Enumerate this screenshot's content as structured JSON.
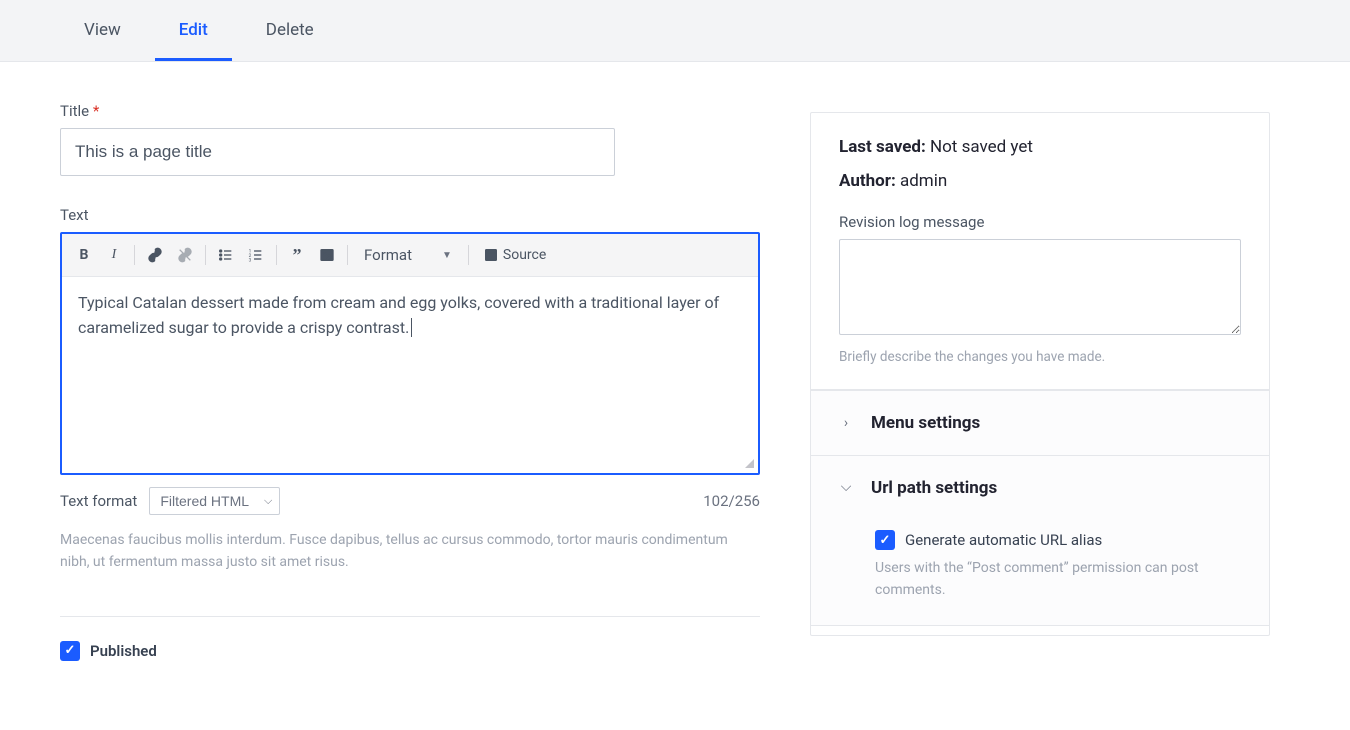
{
  "tabs": {
    "view": "View",
    "edit": "Edit",
    "delete": "Delete"
  },
  "title": {
    "label": "Title",
    "value": "This is a page title"
  },
  "text": {
    "label": "Text",
    "body": "Typical Catalan dessert made from cream and egg yolks, covered with a traditional layer of caramelized sugar to provide a crispy contrast.",
    "toolbar": {
      "format_label": "Format",
      "source_label": "Source"
    },
    "format_label": "Text format",
    "format_value": "Filtered HTML",
    "count": "102/256",
    "help": "Maecenas faucibus mollis interdum. Fusce dapibus, tellus ac cursus commodo, tortor mauris condimentum nibh, ut fermentum massa justo sit amet risus."
  },
  "published": {
    "label": "Published"
  },
  "sidebar": {
    "last_saved_label": "Last saved:",
    "last_saved_value": "Not saved yet",
    "author_label": "Author:",
    "author_value": "admin",
    "revision_label": "Revision log message",
    "revision_help": "Briefly describe the changes you have made.",
    "menu_settings": "Menu settings",
    "url_path_settings": "Url path settings",
    "url_alias": {
      "label": "Generate automatic URL alias",
      "help": "Users with the “Post comment” permission can post comments."
    }
  }
}
